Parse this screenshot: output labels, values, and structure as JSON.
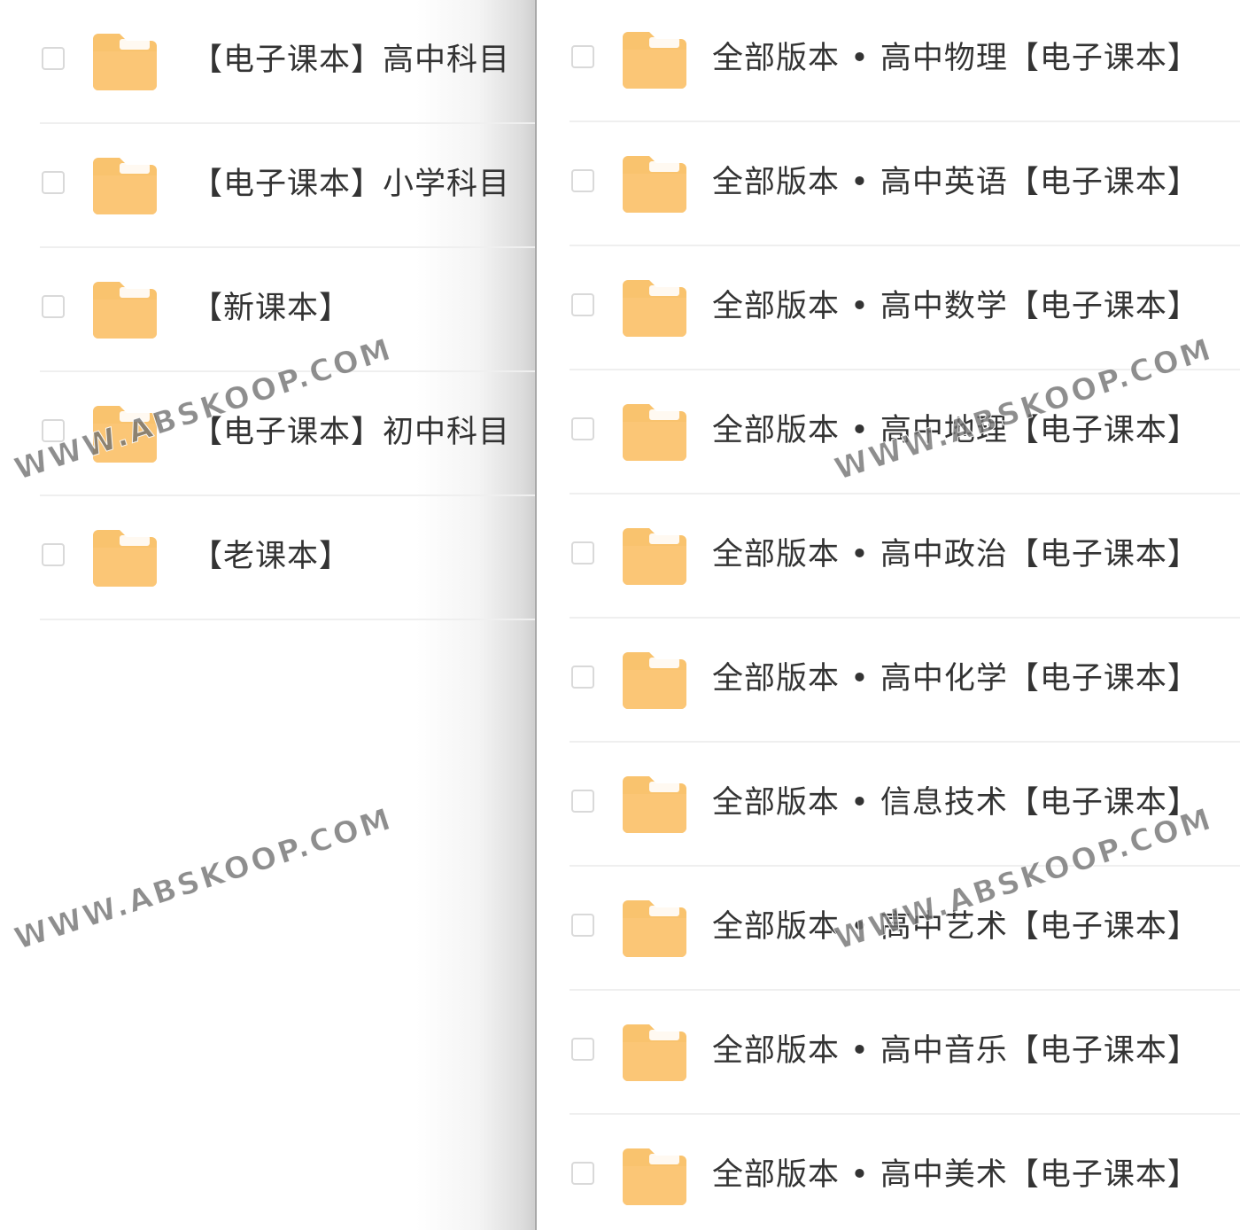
{
  "left_panel": {
    "items": [
      {
        "label": "【电子课本】高中科目"
      },
      {
        "label": "【电子课本】小学科目"
      },
      {
        "label": "【新课本】"
      },
      {
        "label": "【电子课本】初中科目"
      },
      {
        "label": "【老课本】"
      }
    ]
  },
  "right_panel": {
    "items": [
      {
        "label": "全部版本 • 高中物理【电子课本】"
      },
      {
        "label": "全部版本 • 高中英语【电子课本】"
      },
      {
        "label": "全部版本 • 高中数学【电子课本】"
      },
      {
        "label": "全部版本 • 高中地理【电子课本】"
      },
      {
        "label": "全部版本 • 高中政治【电子课本】"
      },
      {
        "label": "全部版本 • 高中化学【电子课本】"
      },
      {
        "label": "全部版本 • 信息技术【电子课本】"
      },
      {
        "label": "全部版本 • 高中艺术【电子课本】"
      },
      {
        "label": "全部版本 • 高中音乐【电子课本】"
      },
      {
        "label": "全部版本 • 高中美术【电子课本】"
      }
    ]
  },
  "watermark": {
    "text": "WWW.ABSKOOP.COM"
  },
  "icons": {
    "folder": "folder-icon"
  },
  "colors": {
    "folder_body": "#f9c36e",
    "folder_tab": "#fbd293",
    "label_text": "#333333",
    "checkbox_border": "#d9d9d9"
  }
}
